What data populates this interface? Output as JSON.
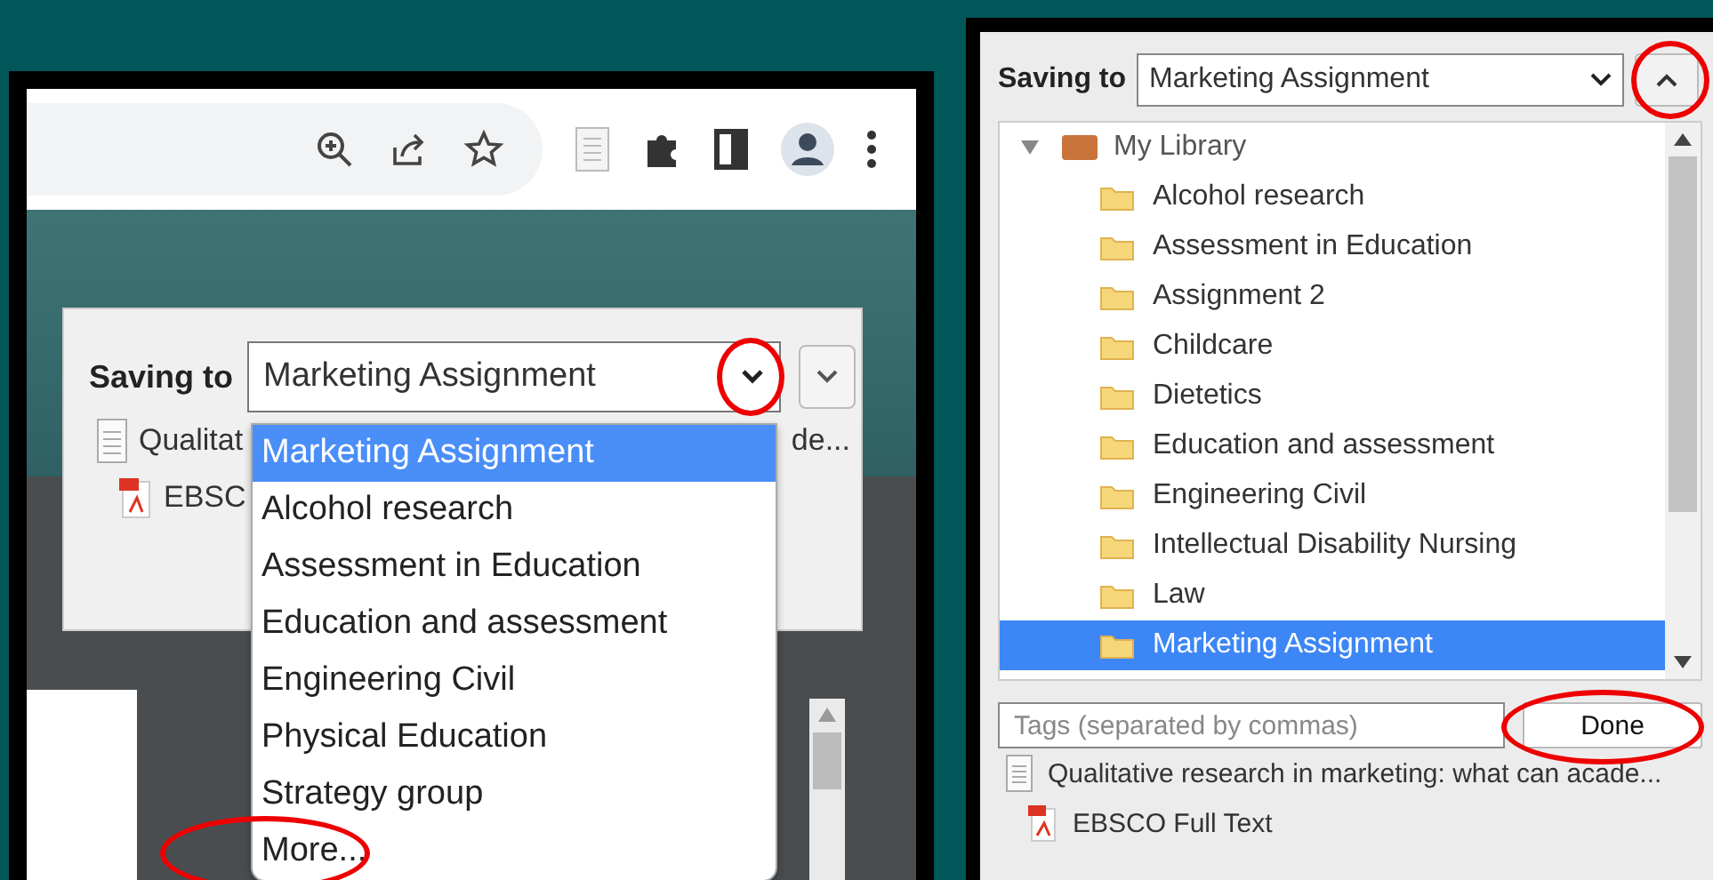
{
  "left_window": {
    "saving_label": "Saving to",
    "select_value": "Marketing Assignment",
    "select_arrow_annotated": true,
    "options": [
      {
        "label": "Marketing Assignment",
        "selected": true,
        "annotated": false
      },
      {
        "label": "Alcohol research",
        "selected": false,
        "annotated": false
      },
      {
        "label": "Assessment in Education",
        "selected": false,
        "annotated": false
      },
      {
        "label": "Education and assessment",
        "selected": false,
        "annotated": false
      },
      {
        "label": "Engineering Civil",
        "selected": false,
        "annotated": false
      },
      {
        "label": "Physical Education",
        "selected": false,
        "annotated": false
      },
      {
        "label": "Strategy group",
        "selected": false,
        "annotated": false
      },
      {
        "label": "More...",
        "selected": false,
        "annotated": true
      }
    ],
    "items": [
      {
        "kind": "document",
        "text": "Qualitat",
        "text_end": "de..."
      },
      {
        "kind": "pdf",
        "text": "EBSC"
      }
    ]
  },
  "right_window": {
    "saving_label": "Saving to",
    "select_value": "Marketing Assignment",
    "collapse_annotated": true,
    "tree": {
      "label": "My Library",
      "expanded": true,
      "children": [
        {
          "label": "Alcohol research",
          "selected": false
        },
        {
          "label": "Assessment in Education",
          "selected": false
        },
        {
          "label": "Assignment 2",
          "selected": false
        },
        {
          "label": "Childcare",
          "selected": false
        },
        {
          "label": "Dietetics",
          "selected": false
        },
        {
          "label": "Education and assessment",
          "selected": false
        },
        {
          "label": "Engineering Civil",
          "selected": false
        },
        {
          "label": "Intellectual Disability Nursing",
          "selected": false
        },
        {
          "label": "Law",
          "selected": false
        },
        {
          "label": "Marketing Assignment",
          "selected": true
        }
      ]
    },
    "tags": {
      "placeholder": "Tags (separated by commas)"
    },
    "done_button": {
      "label": "Done",
      "annotated": true
    },
    "items": [
      {
        "kind": "document",
        "text": "Qualitative research in marketing: what can acade..."
      },
      {
        "kind": "pdf",
        "text": "EBSCO Full Text"
      }
    ]
  }
}
